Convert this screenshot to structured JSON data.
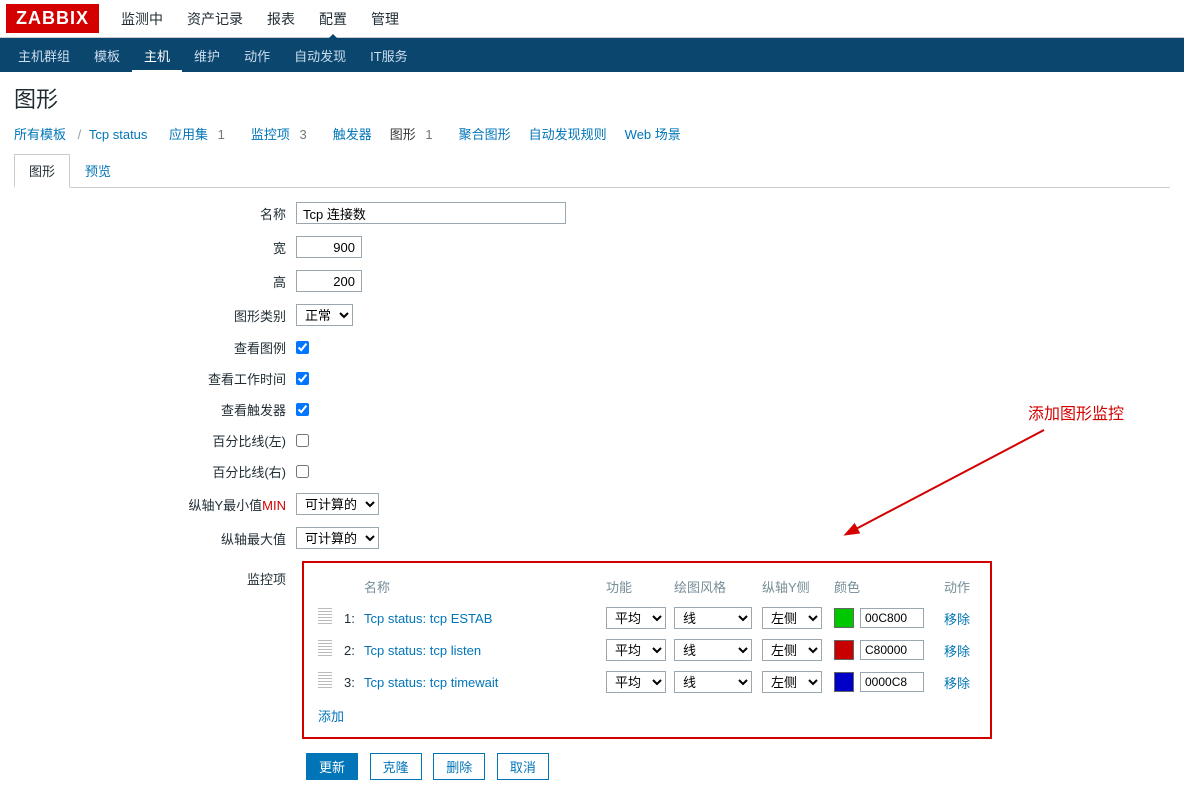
{
  "logo": "ZABBIX",
  "topmenu": [
    "监测中",
    "资产记录",
    "报表",
    "配置",
    "管理"
  ],
  "topmenu_active": 3,
  "submenu": [
    "主机群组",
    "模板",
    "主机",
    "维护",
    "动作",
    "自动发现",
    "IT服务"
  ],
  "submenu_active": 2,
  "page_title": "图形",
  "breadcrumb": {
    "root": "所有模板",
    "template": "Tcp status",
    "items": [
      {
        "label": "应用集",
        "count": "1"
      },
      {
        "label": "监控项",
        "count": "3"
      },
      {
        "label": "触发器",
        "count": ""
      },
      {
        "label": "图形",
        "count": "1",
        "active": true
      },
      {
        "label": "聚合图形",
        "count": ""
      },
      {
        "label": "自动发现规则",
        "count": ""
      },
      {
        "label": "Web 场景",
        "count": ""
      }
    ]
  },
  "tabs": [
    "图形",
    "预览"
  ],
  "tabs_active": 0,
  "labels": {
    "name": "名称",
    "width": "宽",
    "height": "高",
    "gtype": "图形类别",
    "legend": "查看图例",
    "worktime": "查看工作时间",
    "triggers": "查看触发器",
    "pleft": "百分比线(左)",
    "pright": "百分比线(右)",
    "ymin_pre": "纵轴Y最小值",
    "ymin_red": "MIN",
    "ymax": "纵轴最大值",
    "items": "监控项"
  },
  "values": {
    "name": "Tcp 连接数",
    "width": "900",
    "height": "200",
    "gtype": "正常",
    "legend": true,
    "worktime": true,
    "triggers": true,
    "pleft": false,
    "pright": false,
    "ymin": "可计算的",
    "ymax": "可计算的"
  },
  "item_headers": {
    "name": "名称",
    "func": "功能",
    "style": "绘图风格",
    "yaxis": "纵轴Y侧",
    "color": "颜色",
    "action": "动作"
  },
  "item_rows": [
    {
      "n": "1:",
      "name": "Tcp status: tcp ESTAB",
      "func": "平均",
      "style": "线",
      "yaxis": "左侧",
      "color": "00C800",
      "swatch": "#00c800"
    },
    {
      "n": "2:",
      "name": "Tcp status: tcp listen",
      "func": "平均",
      "style": "线",
      "yaxis": "左侧",
      "color": "C80000",
      "swatch": "#c80000"
    },
    {
      "n": "3:",
      "name": "Tcp status: tcp timewait",
      "func": "平均",
      "style": "线",
      "yaxis": "左侧",
      "color": "0000C8",
      "swatch": "#0000c8"
    }
  ],
  "add_text": "添加",
  "remove_text": "移除",
  "buttons": {
    "update": "更新",
    "clone": "克隆",
    "delete": "删除",
    "cancel": "取消"
  },
  "annotation": "添加图形监控"
}
